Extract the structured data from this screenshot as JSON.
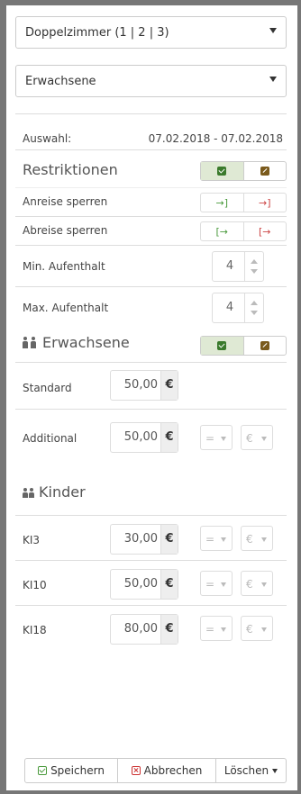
{
  "room_select": {
    "value": "Doppelzimmer (1 | 2 | 3)"
  },
  "guest_select": {
    "value": "Erwachsene"
  },
  "selection": {
    "label": "Auswahl:",
    "range": "07.02.2018 - 07.02.2018"
  },
  "restrictions": {
    "title": "Restriktionen",
    "arrival_label": "Anreise sperren",
    "departure_label": "Abreise sperren",
    "min_stay_label": "Min. Aufenthalt",
    "min_stay_value": "4",
    "max_stay_label": "Max. Aufenthalt",
    "max_stay_value": "4"
  },
  "adults": {
    "title": "Erwachsene",
    "rows": [
      {
        "label": "Standard",
        "price": "50,00",
        "currency": "€"
      },
      {
        "label": "Additional",
        "price": "50,00",
        "currency": "€",
        "op": "=",
        "unit": "€"
      }
    ]
  },
  "children": {
    "title": "Kinder",
    "rows": [
      {
        "label": "KI3",
        "price": "30,00",
        "currency": "€",
        "op": "=",
        "unit": "€"
      },
      {
        "label": "KI10",
        "price": "50,00",
        "currency": "€",
        "op": "=",
        "unit": "€"
      },
      {
        "label": "KI18",
        "price": "80,00",
        "currency": "€",
        "op": "=",
        "unit": "€"
      }
    ]
  },
  "footer": {
    "save": "Speichern",
    "cancel": "Abbrechen",
    "delete": "Löschen"
  },
  "colors": {
    "check": "#3a7a2c",
    "edit": "#7a5a1c",
    "green": "#4a9a3c",
    "red": "#cc4444"
  },
  "icons": [
    "check-icon",
    "edit-icon",
    "arrival-unlock-icon",
    "arrival-lock-icon",
    "departure-unlock-icon",
    "departure-lock-icon",
    "people-icon",
    "children-icon"
  ]
}
